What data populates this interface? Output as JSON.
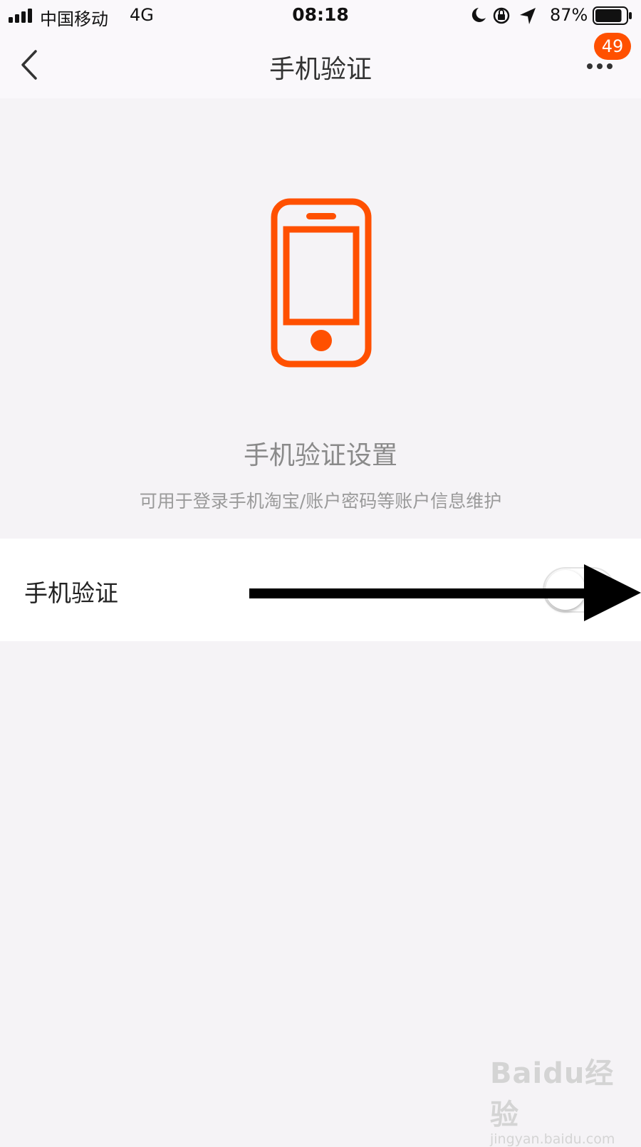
{
  "status_bar": {
    "carrier": "中国移动",
    "network": "4G",
    "time": "08:18",
    "battery_percent": "87%",
    "battery_level": 0.87,
    "icons": [
      "signal-icon",
      "moon-icon",
      "rotation-lock-icon",
      "location-arrow-icon",
      "battery-icon"
    ]
  },
  "nav_bar": {
    "title": "手机验证",
    "back_icon": "chevron-left-icon",
    "more_icon": "more-dots-icon",
    "badge_count": "49"
  },
  "hero": {
    "icon": "phone-icon",
    "title": "手机验证设置",
    "subtitle": "可用于登录手机淘宝/账户密码等账户信息维护"
  },
  "setting_row": {
    "label": "手机验证",
    "toggle_on": false
  },
  "annotation": {
    "icon": "arrow-right-icon"
  },
  "watermark": {
    "logo": "Baidu经验",
    "url": "jingyan.baidu.com"
  },
  "colors": {
    "accent": "#ff5000",
    "background": "#f5f3f6",
    "card": "#ffffff",
    "muted_text": "#8a8a8a"
  }
}
